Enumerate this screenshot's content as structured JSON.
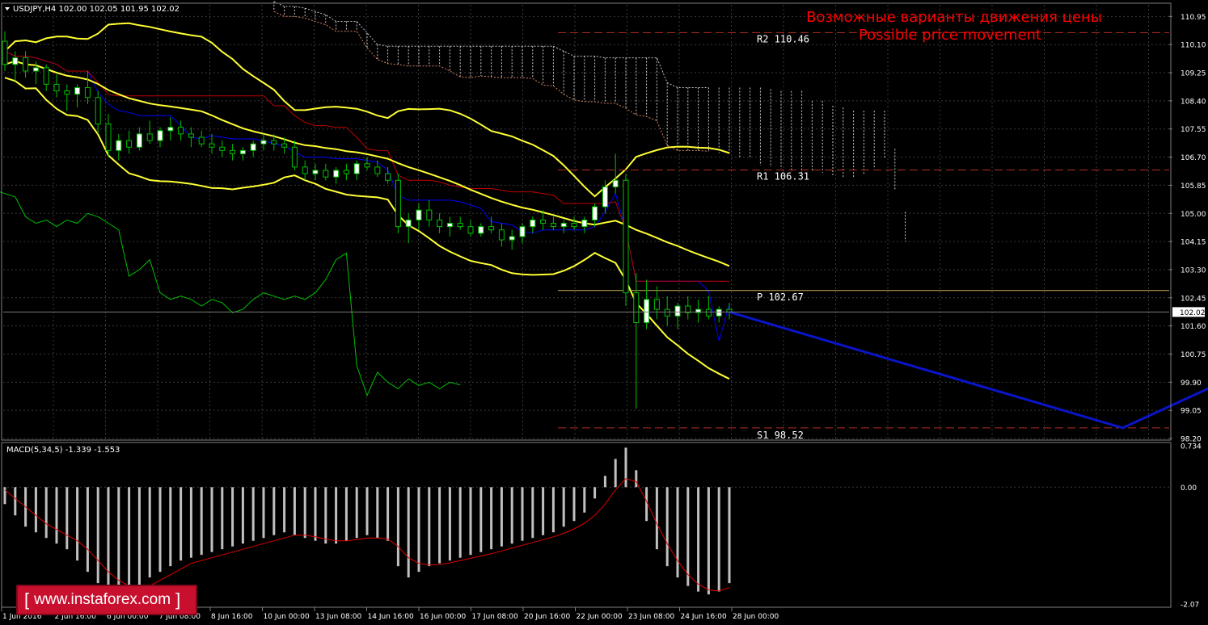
{
  "header": {
    "symbol_line": "USDJPY,H4  102.00 102.05 101.95 102.02",
    "headline_ru": "Возможные варианты движения цены",
    "headline_en": "Possible price movement"
  },
  "levels": [
    {
      "name": "R2",
      "label": "R2 110.46",
      "value": 110.46,
      "color": "#b03020"
    },
    {
      "name": "R1",
      "label": "R1 106.31",
      "value": 106.31,
      "color": "#b03020"
    },
    {
      "name": "P",
      "label": "P 102.67",
      "value": 102.67,
      "color": "#c8b060"
    },
    {
      "name": "S1",
      "label": "S1 98.52",
      "value": 98.52,
      "color": "#b03020"
    }
  ],
  "current_price": {
    "value": 102.02,
    "label": "102.02"
  },
  "price_axis_ticks": [
    "110.95",
    "110.10",
    "109.25",
    "108.40",
    "107.55",
    "106.70",
    "105.85",
    "105.00",
    "104.15",
    "103.30",
    "102.45",
    "101.60",
    "100.75",
    "99.90",
    "99.05",
    "98.20"
  ],
  "time_axis_ticks": [
    "1 Jun 2016",
    "2 Jun 16:00",
    "6 Jun 00:00",
    "7 Jun 08:00",
    "8 Jun 16:00",
    "10 Jun 00:00",
    "13 Jun 08:00",
    "14 Jun 16:00",
    "16 Jun 00:00",
    "17 Jun 08:00",
    "20 Jun 16:00",
    "22 Jun 00:00",
    "23 Jun 08:00",
    "24 Jun 16:00",
    "28 Jun 00:00"
  ],
  "macd_panel": {
    "label": "MACD(5,34,5) -1.339 -1.553",
    "axis_ticks": [
      "0.734",
      "0.00",
      "-2.07"
    ]
  },
  "watermark": {
    "text": "www.instaforex.com",
    "open": "[",
    "close": "]"
  },
  "colors": {
    "background": "#000000",
    "grid": "#3a3a3a",
    "axis_text": "#ffffff",
    "bull_candle": "#ffffff",
    "bear_candle": "#000000",
    "candle_wick": "#00c000",
    "bollinger": "#ffff33",
    "kijun": "#c00000",
    "tenkun": "#0000ff",
    "chikou": "#00c000",
    "kumo": "#ffffff",
    "forecast": "#0a14c8",
    "headline": "#ff0000",
    "macd_hist": "#c0c0c0",
    "macd_signal": "#e00000"
  },
  "chart_data": {
    "type": "candlestick",
    "symbol": "USDJPY",
    "timeframe": "H4",
    "ylim": [
      98.2,
      111.3
    ],
    "macd_ylim": [
      -2.07,
      0.734
    ],
    "candles": [
      [
        110.2,
        110.5,
        109.3,
        109.5
      ],
      [
        109.5,
        109.9,
        109.0,
        109.7
      ],
      [
        109.7,
        109.9,
        109.1,
        109.3
      ],
      [
        109.3,
        109.6,
        108.9,
        109.4
      ],
      [
        109.4,
        109.5,
        108.7,
        108.9
      ],
      [
        108.9,
        109.2,
        108.5,
        108.7
      ],
      [
        108.7,
        108.9,
        108.1,
        108.6
      ],
      [
        108.6,
        108.9,
        108.2,
        108.8
      ],
      [
        108.8,
        109.3,
        108.3,
        108.5
      ],
      [
        108.5,
        108.7,
        107.4,
        107.7
      ],
      [
        107.7,
        108.0,
        106.7,
        106.9
      ],
      [
        106.9,
        107.4,
        106.6,
        107.2
      ],
      [
        107.2,
        107.5,
        106.8,
        107.0
      ],
      [
        107.0,
        107.6,
        106.9,
        107.4
      ],
      [
        107.4,
        107.8,
        107.1,
        107.2
      ],
      [
        107.2,
        107.6,
        107.0,
        107.5
      ],
      [
        107.5,
        107.9,
        107.2,
        107.6
      ],
      [
        107.6,
        107.8,
        107.2,
        107.4
      ],
      [
        107.4,
        107.6,
        107.0,
        107.3
      ],
      [
        107.3,
        107.5,
        107.0,
        107.1
      ],
      [
        107.1,
        107.4,
        106.8,
        107.0
      ],
      [
        107.0,
        107.2,
        106.7,
        106.9
      ],
      [
        106.9,
        107.1,
        106.6,
        106.8
      ],
      [
        106.8,
        107.0,
        106.6,
        106.9
      ],
      [
        106.9,
        107.2,
        106.7,
        107.1
      ],
      [
        107.1,
        107.4,
        106.9,
        107.2
      ],
      [
        107.2,
        107.4,
        106.9,
        107.1
      ],
      [
        107.1,
        107.3,
        106.8,
        107.0
      ],
      [
        107.0,
        107.2,
        106.3,
        106.4
      ],
      [
        106.4,
        106.6,
        106.0,
        106.2
      ],
      [
        106.2,
        106.5,
        106.0,
        106.3
      ],
      [
        106.3,
        106.5,
        106.0,
        106.1
      ],
      [
        106.1,
        106.4,
        105.9,
        106.3
      ],
      [
        106.3,
        106.5,
        106.0,
        106.2
      ],
      [
        106.2,
        106.6,
        106.0,
        106.5
      ],
      [
        106.5,
        106.7,
        106.3,
        106.4
      ],
      [
        106.4,
        106.6,
        106.1,
        106.2
      ],
      [
        106.2,
        106.4,
        105.9,
        106.0
      ],
      [
        106.0,
        106.2,
        104.4,
        104.6
      ],
      [
        104.6,
        105.0,
        104.1,
        104.8
      ],
      [
        104.8,
        105.3,
        104.5,
        105.1
      ],
      [
        105.1,
        105.4,
        104.6,
        104.8
      ],
      [
        104.8,
        105.0,
        104.4,
        104.6
      ],
      [
        104.6,
        104.9,
        104.3,
        104.7
      ],
      [
        104.7,
        104.9,
        104.5,
        104.6
      ],
      [
        104.6,
        104.8,
        104.3,
        104.4
      ],
      [
        104.4,
        104.7,
        104.3,
        104.6
      ],
      [
        104.6,
        104.9,
        104.4,
        104.5
      ],
      [
        104.5,
        104.7,
        104.0,
        104.2
      ],
      [
        104.2,
        104.5,
        103.9,
        104.3
      ],
      [
        104.3,
        104.7,
        104.1,
        104.6
      ],
      [
        104.6,
        104.9,
        104.4,
        104.8
      ],
      [
        104.8,
        105.1,
        104.5,
        104.7
      ],
      [
        104.7,
        104.9,
        104.5,
        104.6
      ],
      [
        104.6,
        104.8,
        104.4,
        104.7
      ],
      [
        104.7,
        104.9,
        104.5,
        104.6
      ],
      [
        104.6,
        104.9,
        104.4,
        104.8
      ],
      [
        104.8,
        105.3,
        104.6,
        105.2
      ],
      [
        105.2,
        106.0,
        105.0,
        105.8
      ],
      [
        105.8,
        106.8,
        105.6,
        106.0
      ],
      [
        106.0,
        106.2,
        102.2,
        102.6
      ],
      [
        102.6,
        103.2,
        99.1,
        101.7
      ],
      [
        101.7,
        103.0,
        101.5,
        102.4
      ],
      [
        102.4,
        102.8,
        101.8,
        102.1
      ],
      [
        102.1,
        102.5,
        101.6,
        101.9
      ],
      [
        101.9,
        102.3,
        101.5,
        102.2
      ],
      [
        102.2,
        102.5,
        101.8,
        102.0
      ],
      [
        102.0,
        102.4,
        101.7,
        102.1
      ],
      [
        102.1,
        102.5,
        101.8,
        101.9
      ],
      [
        101.9,
        102.2,
        101.7,
        102.1
      ],
      [
        102.1,
        102.3,
        101.8,
        102.02
      ]
    ],
    "macd_histogram": [
      -0.3,
      -0.5,
      -0.7,
      -0.8,
      -0.9,
      -1.0,
      -1.1,
      -1.3,
      -1.5,
      -1.7,
      -1.9,
      -2.0,
      -1.95,
      -1.8,
      -1.6,
      -1.5,
      -1.4,
      -1.3,
      -1.25,
      -1.2,
      -1.15,
      -1.1,
      -1.05,
      -1.0,
      -0.95,
      -0.9,
      -0.85,
      -0.8,
      -0.85,
      -0.9,
      -0.95,
      -1.0,
      -1.0,
      -0.95,
      -0.9,
      -0.85,
      -0.9,
      -0.95,
      -1.4,
      -1.6,
      -1.5,
      -1.4,
      -1.35,
      -1.3,
      -1.25,
      -1.2,
      -1.15,
      -1.1,
      -1.05,
      -1.0,
      -0.95,
      -0.9,
      -0.85,
      -0.8,
      -0.7,
      -0.6,
      -0.45,
      -0.2,
      0.2,
      0.5,
      0.7,
      0.3,
      -0.6,
      -1.1,
      -1.4,
      -1.6,
      -1.75,
      -1.85,
      -1.9,
      -1.85,
      -1.7
    ],
    "macd_signal": [
      -0.05,
      -0.2,
      -0.35,
      -0.5,
      -0.65,
      -0.75,
      -0.85,
      -0.95,
      -1.1,
      -1.3,
      -1.5,
      -1.65,
      -1.75,
      -1.8,
      -1.75,
      -1.65,
      -1.55,
      -1.45,
      -1.35,
      -1.3,
      -1.25,
      -1.2,
      -1.15,
      -1.1,
      -1.05,
      -1.0,
      -0.95,
      -0.9,
      -0.85,
      -0.85,
      -0.88,
      -0.92,
      -0.95,
      -0.95,
      -0.93,
      -0.9,
      -0.9,
      -0.92,
      -1.05,
      -1.25,
      -1.35,
      -1.38,
      -1.37,
      -1.34,
      -1.3,
      -1.26,
      -1.22,
      -1.18,
      -1.13,
      -1.08,
      -1.03,
      -0.98,
      -0.93,
      -0.88,
      -0.82,
      -0.74,
      -0.64,
      -0.5,
      -0.3,
      -0.05,
      0.15,
      0.1,
      -0.25,
      -0.65,
      -1.0,
      -1.3,
      -1.55,
      -1.72,
      -1.82,
      -1.84,
      -1.78
    ],
    "forecast_path": [
      {
        "bar": 70,
        "price": 102.02
      },
      {
        "bar": 108,
        "price": 98.52
      },
      {
        "bar": 119,
        "price": 100.1
      }
    ]
  }
}
